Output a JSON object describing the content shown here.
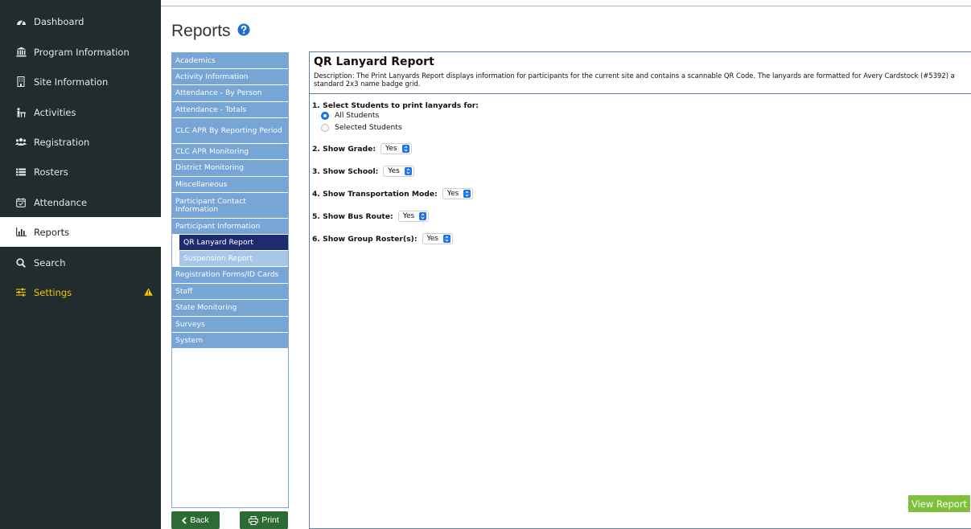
{
  "nav": {
    "items": [
      {
        "label": "Dashboard",
        "icon": "dashboard-gauge-icon"
      },
      {
        "label": "Program Information",
        "icon": "bank-building-icon"
      },
      {
        "label": "Site Information",
        "icon": "building-icon"
      },
      {
        "label": "Activities",
        "icon": "activities-figure-icon"
      },
      {
        "label": "Registration",
        "icon": "users-group-icon"
      },
      {
        "label": "Rosters",
        "icon": "list-icon"
      },
      {
        "label": "Attendance",
        "icon": "calendar-check-icon"
      },
      {
        "label": "Reports",
        "icon": "bar-chart-icon"
      },
      {
        "label": "Search",
        "icon": "search-icon"
      },
      {
        "label": "Settings",
        "icon": "sliders-icon"
      }
    ],
    "active": "Reports",
    "colors": {
      "background": "#222b2d",
      "settings": "#f2c300",
      "warning": "#f2c300"
    }
  },
  "page": {
    "title": "Reports",
    "help_icon": "help-circle-icon"
  },
  "report_list": {
    "items": [
      {
        "label": "Academics"
      },
      {
        "label": "Activity Information"
      },
      {
        "label": "Attendance - By Person"
      },
      {
        "label": "Attendance - Totals"
      },
      {
        "label": "CLC APR By Reporting Period"
      },
      {
        "label": "CLC APR Monitoring"
      },
      {
        "label": "District Monitoring"
      },
      {
        "label": "Miscellaneous"
      },
      {
        "label": "Participant Contact Information"
      },
      {
        "label": "Participant Information"
      },
      {
        "label": "QR Lanyard Report"
      },
      {
        "label": "Suspension Report"
      },
      {
        "label": "Registration Forms/ID Cards"
      },
      {
        "label": "Staff"
      },
      {
        "label": "State Monitoring"
      },
      {
        "label": "Surveys"
      },
      {
        "label": "System"
      }
    ],
    "selected": "QR Lanyard Report",
    "colors": {
      "item": "#77a5d6",
      "subitem": "#a6c7e6",
      "selected": "#1e2b6f"
    }
  },
  "buttons": {
    "back": "Back",
    "print": "Print",
    "view_report": "View Report"
  },
  "report": {
    "title": "QR Lanyard Report",
    "description": "Description: The Print Lanyards Report displays information for participants for the current site and contains a scannable QR Code. The lanyards are formatted for Avery Cardstock (#5392) a standard 2x3 name badge grid.",
    "q1_label": "1. Select Students to print lanyards for:",
    "q1_options": [
      "All Students",
      "Selected Students"
    ],
    "q1_selected": "All Students",
    "options": [
      {
        "label": "2. Show Grade:",
        "value": "Yes"
      },
      {
        "label": "3. Show School:",
        "value": "Yes"
      },
      {
        "label": "4. Show Transportation Mode:",
        "value": "Yes"
      },
      {
        "label": "5. Show Bus Route:",
        "value": "Yes"
      },
      {
        "label": "6. Show Group Roster(s):",
        "value": "Yes"
      }
    ]
  }
}
